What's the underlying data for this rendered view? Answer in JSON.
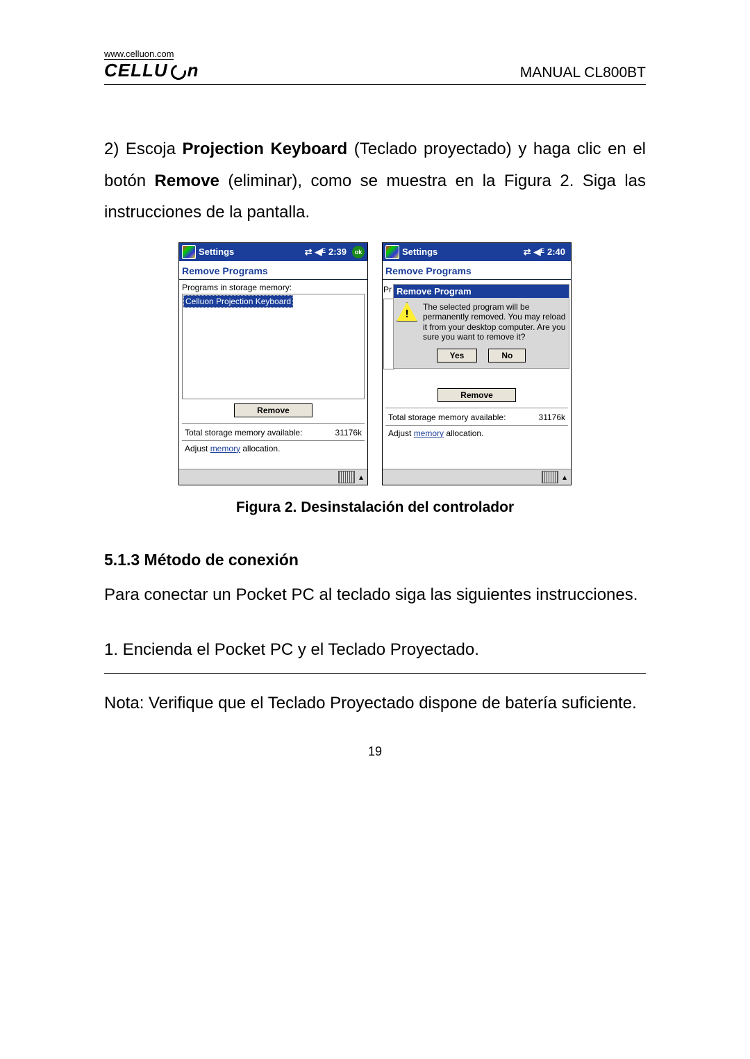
{
  "header": {
    "url": "www.celluon.com",
    "brand_left": "CELLU",
    "brand_right": "n",
    "manual": "MANUAL CL800BT"
  },
  "p1_num": "2) ",
  "p1_a": "Escoja ",
  "p1_b": "Projection Keyboard",
  "p1_c": " (Teclado proyectado) y haga clic en el botón ",
  "p1_d": "Remove",
  "p1_e": " (eliminar), como se muestra en la Figura 2. Siga las instrucciones de la pantalla.",
  "screen1": {
    "title": "Settings",
    "time": "2:39",
    "section": "Remove Programs",
    "label": "Programs in storage memory:",
    "item": "Celluon Projection Keyboard",
    "remove": "Remove",
    "total_label": "Total storage memory available:",
    "total_value": "31176k",
    "adjust_a": "Adjust ",
    "adjust_link": "memory",
    "adjust_b": " allocation."
  },
  "screen2": {
    "title": "Settings",
    "time": "2:40",
    "section": "Remove Programs",
    "behind_pr": "Pr",
    "modal_title": "Remove Program",
    "modal_text": "The selected program will be permanently removed. You may reload it from your desktop computer. Are you sure you want to remove it?",
    "yes": "Yes",
    "no": "No",
    "remove": "Remove",
    "total_label": "Total storage memory available:",
    "total_value": "31176k",
    "adjust_a": "Adjust ",
    "adjust_link": "memory",
    "adjust_b": " allocation."
  },
  "caption": "Figura 2. Desinstalación del controlador",
  "subhead": "5.1.3 Método de conexión",
  "p2": "Para conectar un Pocket PC al teclado siga las siguientes instrucciones.",
  "p3": "1. Encienda el Pocket PC y el Teclado Proyectado.",
  "note": "Nota: Verifique que el Teclado Proyectado dispone de batería suficiente.",
  "page_num": "19"
}
